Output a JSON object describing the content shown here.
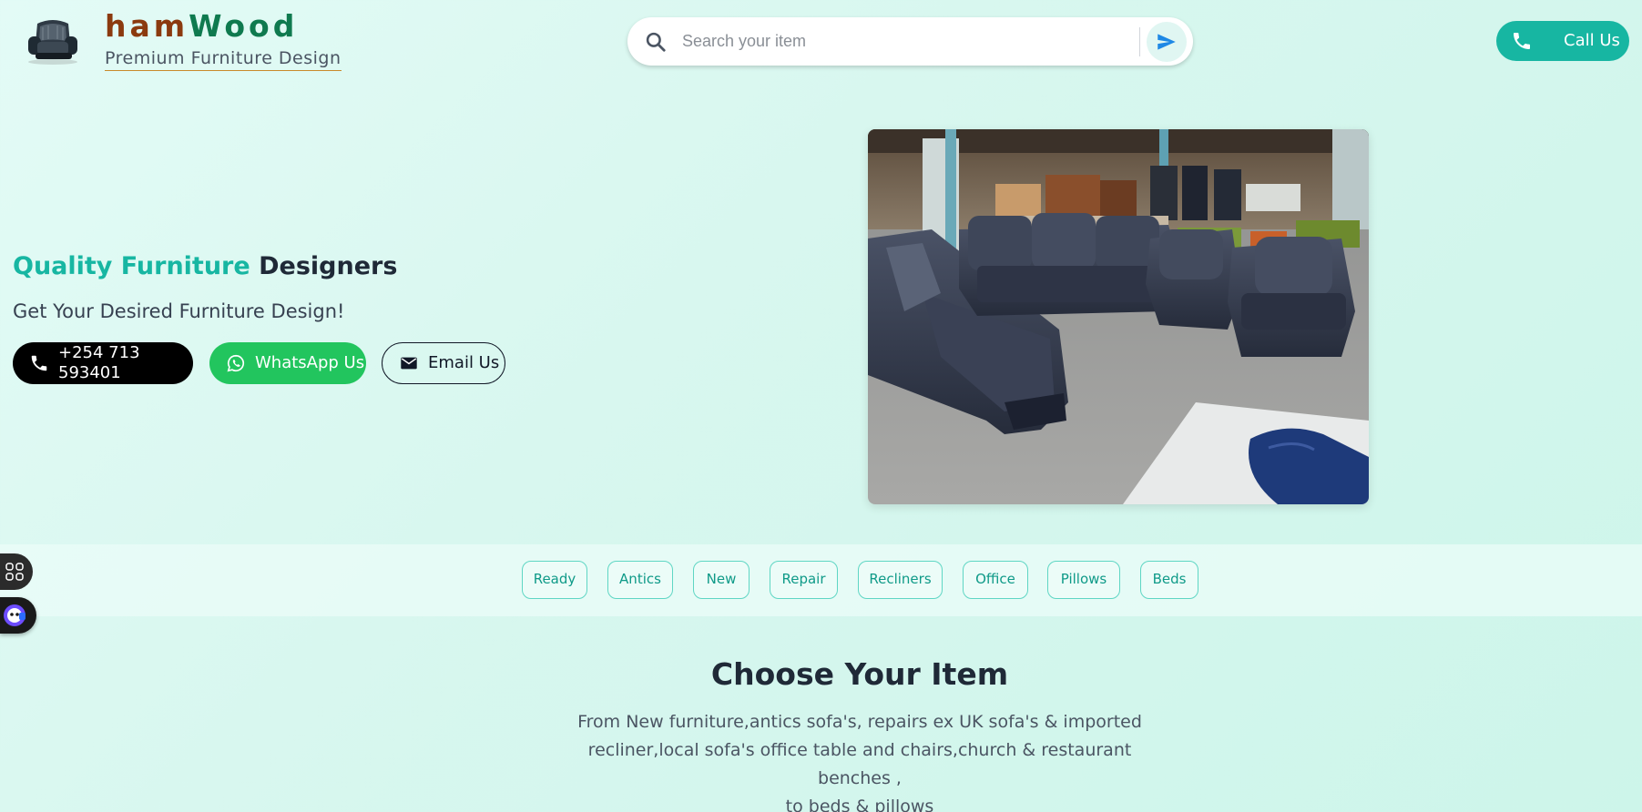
{
  "header": {
    "brand_part1": "ham",
    "brand_part2": "Wood",
    "tagline": "Premium Furniture Design",
    "search_placeholder": "Search your item",
    "call_label": "Call Us"
  },
  "hero": {
    "title_accent": "Quality Furniture",
    "title_rest": "Designers",
    "subtitle": "Get Your Desired Furniture Design!",
    "phone_label": "+254 713 593401",
    "whatsapp_label": "WhatsApp Us",
    "email_label": "Email Us"
  },
  "categories": [
    "Ready",
    "Antics",
    "New",
    "Repair",
    "Recliners",
    "Office",
    "Pillows",
    "Beds"
  ],
  "choose": {
    "title": "Choose Your Item",
    "description_lines": [
      "From New furniture,antics sofa's, repairs ex UK sofa's & imported",
      "recliner,local sofa's office table and chairs,church & restaurant benches ,",
      "to beds & pillows"
    ]
  },
  "colors": {
    "brand_ham": "#8b3a0f",
    "brand_wood": "#0f7a4f",
    "accent_teal": "#17b6a2",
    "whatsapp_green": "#22c55e",
    "phone_black": "#000000"
  },
  "icons": {
    "logo": "recliner-chair-logo",
    "search": "search-icon",
    "send": "send-icon",
    "phone": "phone-icon",
    "whatsapp": "whatsapp-icon",
    "email": "mail-icon",
    "apps": "apps-grid-icon",
    "assistant": "assistant-bot-icon"
  }
}
